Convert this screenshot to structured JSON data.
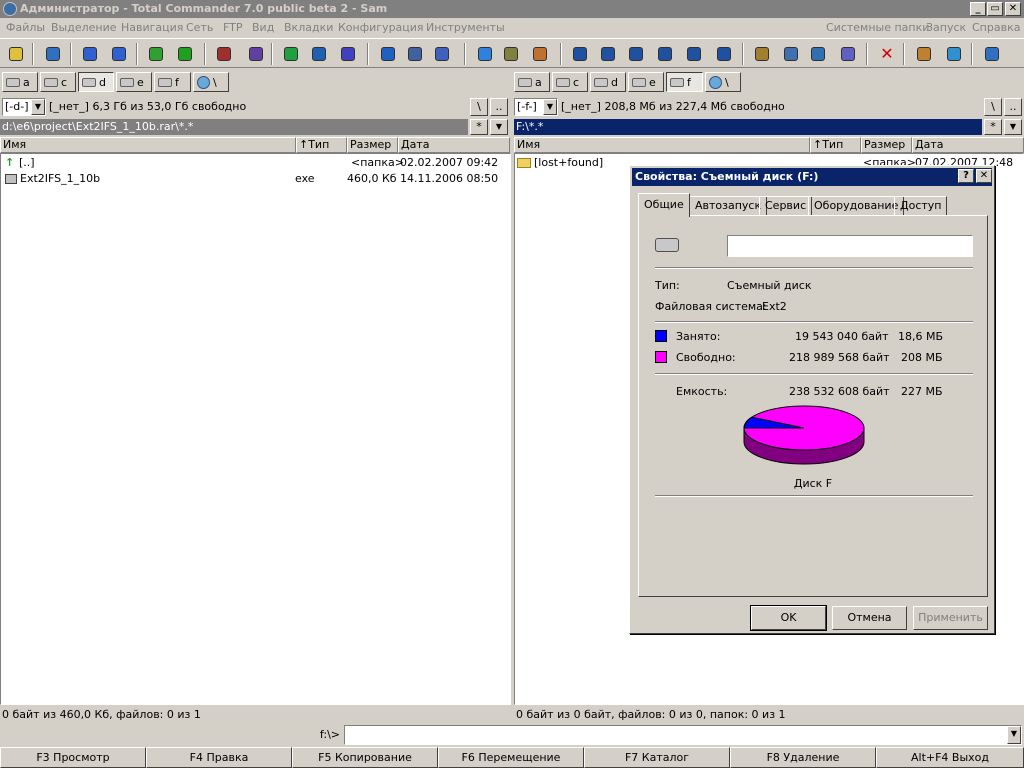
{
  "window": {
    "title": "Администратор - Total Commander 7.0 public beta 2 - Sam",
    "min": "_",
    "max": "▭",
    "close": "✕"
  },
  "menu": {
    "left": [
      "Файлы",
      "Выделение",
      "Навигация",
      "Сеть",
      "FTP",
      "Вид",
      "Вкладки",
      "Конфигурация",
      "Инструменты"
    ],
    "right": [
      "Системные папки",
      "Запуск",
      "Справка"
    ]
  },
  "toolbar": {
    "icons": [
      "lightbulb-icon",
      "refresh-icon",
      "back-icon",
      "forward-icon",
      "network-icon",
      "cube-icon",
      "archive-icon",
      "pack-icon",
      "sort-icon",
      "sort-az-icon",
      "checklist-icon",
      "browser-icon",
      "ftp-icon",
      "notepad-icon",
      "star-icon",
      "search-icon",
      "compare-icon",
      "window-icon",
      "window2-icon",
      "window3-icon",
      "window4-icon",
      "window5-icon",
      "window6-icon",
      "tools-icon",
      "magnify-icon",
      "sync-icon",
      "wizard-icon",
      "delete-icon",
      "edit-icon",
      "timer-icon",
      "help-icon"
    ]
  },
  "colors": {
    "accent": "#0a246a",
    "used": "#0000ff",
    "free": "#ff00ff"
  },
  "left": {
    "drives": [
      {
        "icon": "floppy-icon",
        "label": "a"
      },
      {
        "icon": "disk-icon",
        "label": "c"
      },
      {
        "icon": "disk-icon",
        "label": "d"
      },
      {
        "icon": "disk-icon",
        "label": "e"
      },
      {
        "icon": "usb-icon",
        "label": "f"
      },
      {
        "icon": "net-icon",
        "label": "\\"
      }
    ],
    "drive_select": "[-d-]",
    "drive_info": "[_нет_]  6,3 Гб из 53,0 Гб свободно",
    "root_btn": "\\",
    "up_btn": "..",
    "path": "d:\\e6\\project\\Ext2IFS_1_10b.rar\\*.*",
    "filter": "*",
    "cols": {
      "name": "Имя",
      "type": "↑Тип",
      "size": "Размер",
      "date": "Дата"
    },
    "files": [
      {
        "name": "[..]",
        "type": "",
        "size": "<папка>",
        "date": "02.02.2007 09:42"
      },
      {
        "name": "Ext2IFS_1_10b",
        "type": "exe",
        "size": "460,0 Кб",
        "date": "14.11.2006 08:50"
      }
    ],
    "status": "0 байт из 460,0 Кб, файлов: 0 из 1"
  },
  "right": {
    "drives": [
      {
        "icon": "floppy-icon",
        "label": "a"
      },
      {
        "icon": "disk-icon",
        "label": "c"
      },
      {
        "icon": "disk-icon",
        "label": "d"
      },
      {
        "icon": "disk-icon",
        "label": "e"
      },
      {
        "icon": "usb-icon",
        "label": "f"
      },
      {
        "icon": "net-icon",
        "label": "\\"
      }
    ],
    "drive_select": "[-f-]",
    "drive_info": "[_нет_]  208,8 Мб из 227,4 Мб свободно",
    "root_btn": "\\",
    "up_btn": "..",
    "path": "F:\\*.*",
    "filter": "*",
    "cols": {
      "name": "Имя",
      "type": "↑Тип",
      "size": "Размер",
      "date": "Дата"
    },
    "files": [
      {
        "name": "[lost+found]",
        "type": "",
        "size": "<папка>",
        "date": "07.02.2007 12:48"
      }
    ],
    "status": "0 байт из 0 байт, файлов: 0 из 0, папок: 0 из 1"
  },
  "cmdline": {
    "prompt": "f:\\>",
    "value": ""
  },
  "fkeys": [
    "F3 Просмотр",
    "F4 Правка",
    "F5 Копирование",
    "F6 Перемещение",
    "F7 Каталог",
    "F8 Удаление",
    "Alt+F4 Выход"
  ],
  "dialog": {
    "title": "Свойства: Съемный диск (F:)",
    "help": "?",
    "close": "✕",
    "tabs": [
      "Общие",
      "Автозапуск",
      "Сервис",
      "Оборудование",
      "Доступ"
    ],
    "label_value": "",
    "type_label": "Тип:",
    "type_value": "Съемный диск",
    "fs_label": "Файловая система:",
    "fs_value": "Ext2",
    "used_label": "Занято:",
    "used_bytes": "19 543 040 байт",
    "used_h": "18,6 МБ",
    "free_label": "Свободно:",
    "free_bytes": "218 989 568 байт",
    "free_h": "208 МБ",
    "cap_label": "Емкость:",
    "cap_bytes": "238 532 608 байт",
    "cap_h": "227 МБ",
    "used_fraction": 0.082,
    "disk_label": "Диск F",
    "ok": "OK",
    "cancel": "Отмена",
    "apply": "Применить"
  }
}
